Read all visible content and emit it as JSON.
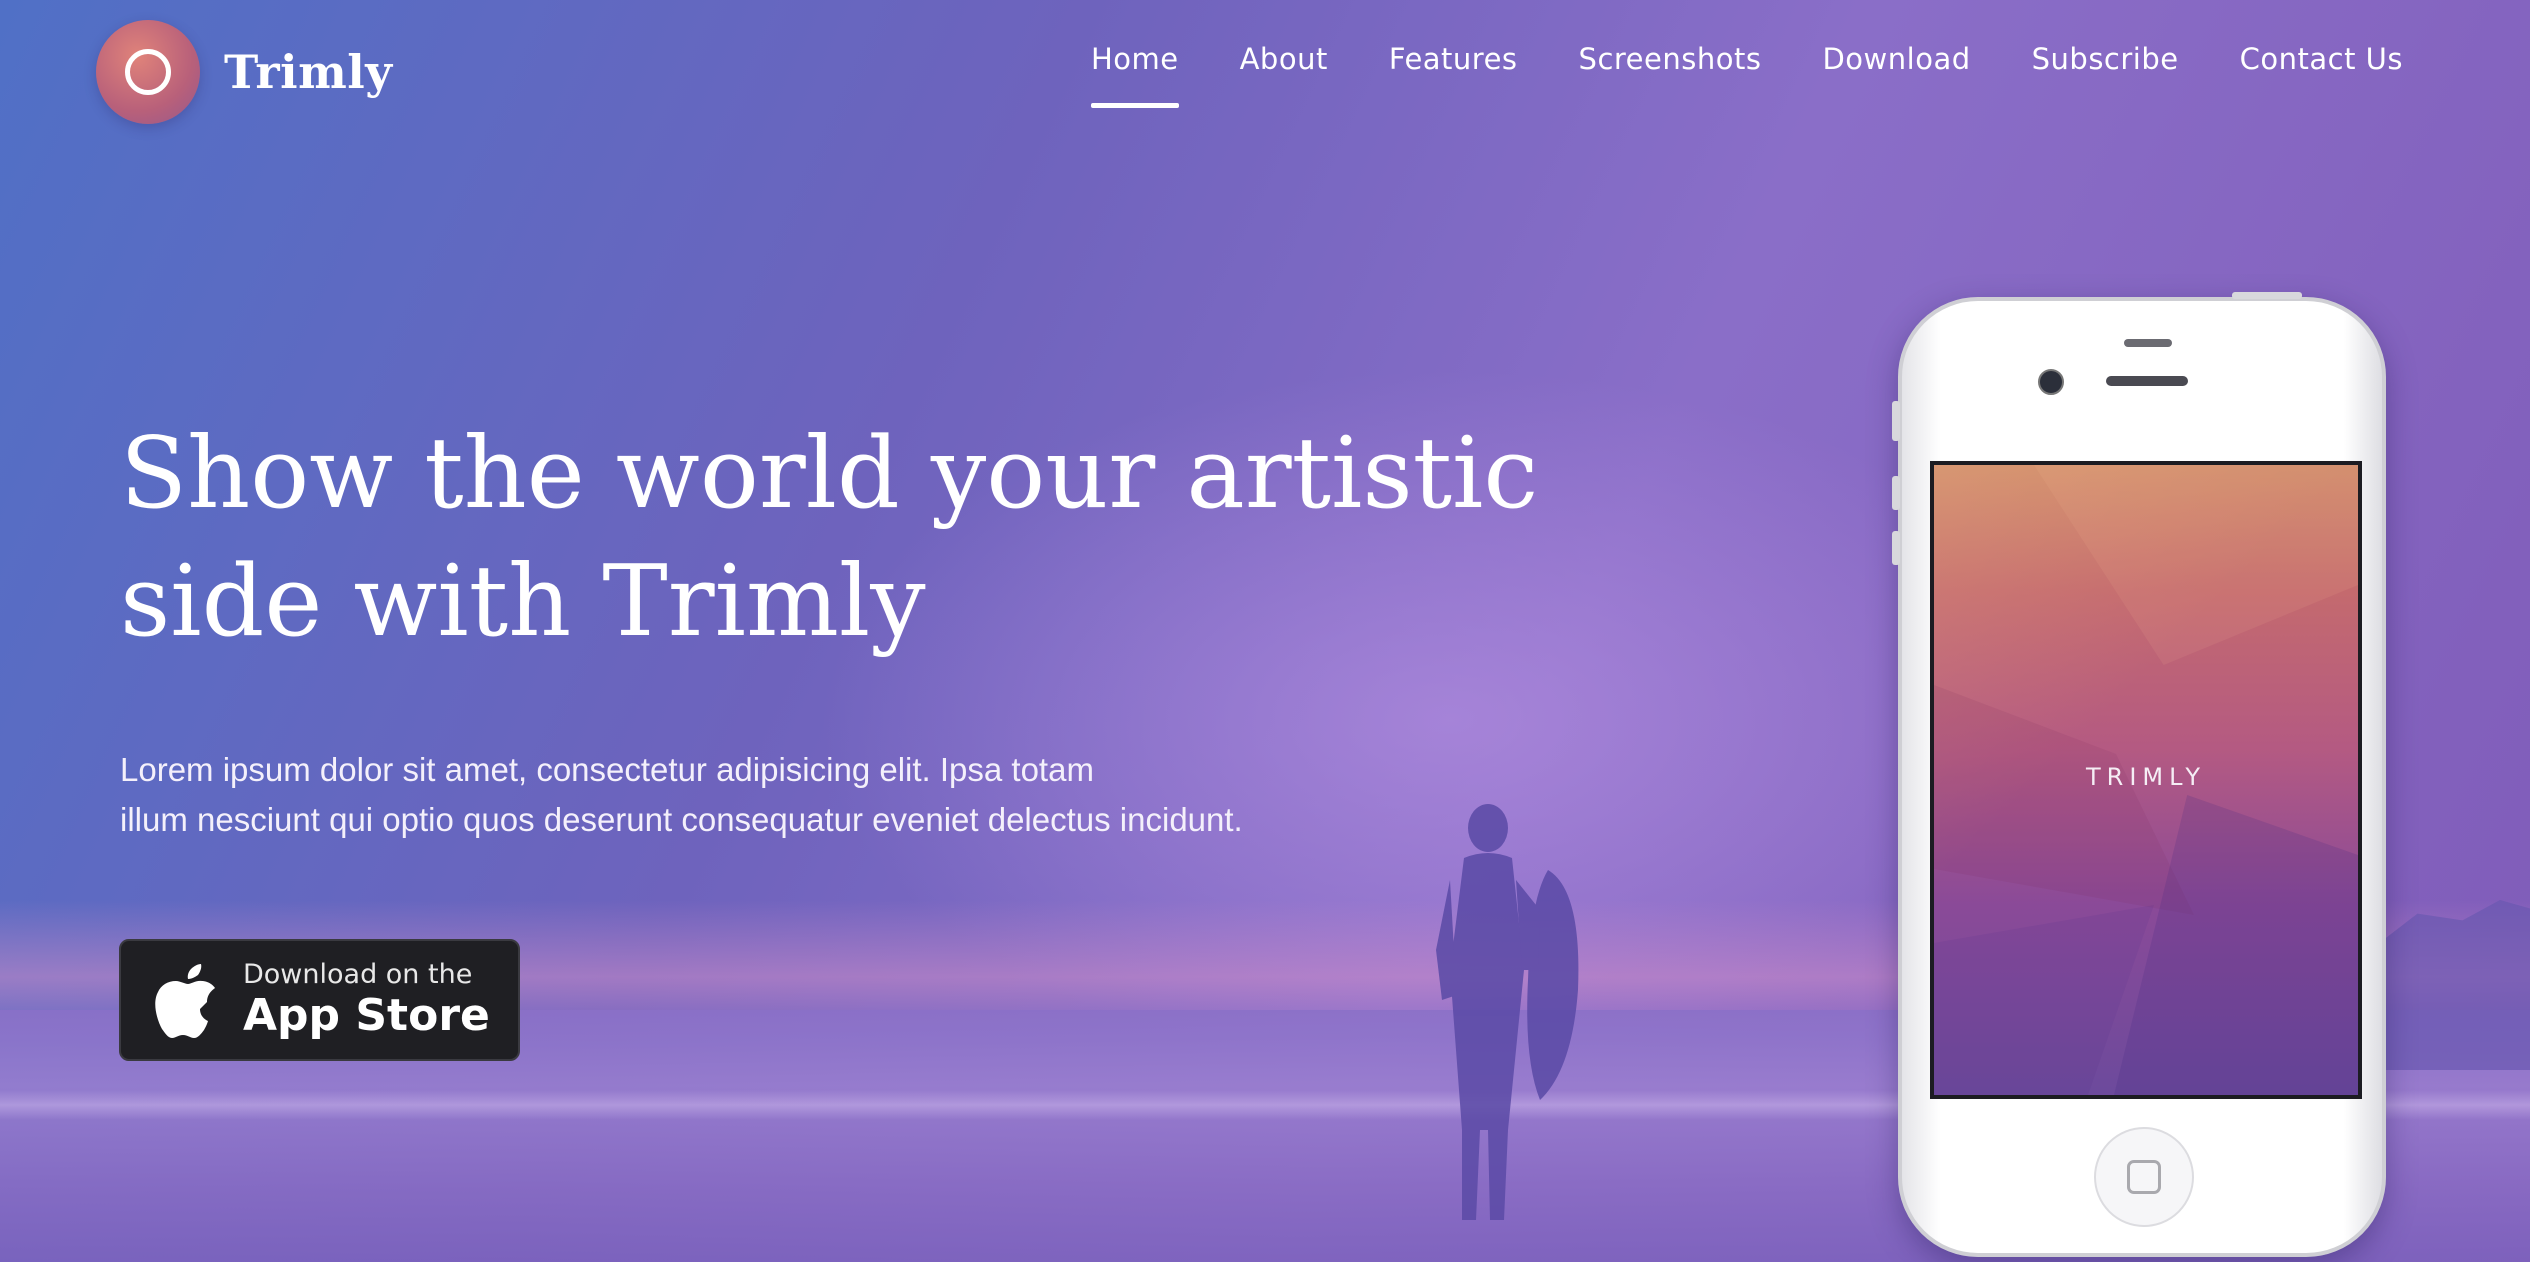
{
  "brand": {
    "name": "Trimly"
  },
  "nav": {
    "items": [
      "Home",
      "About",
      "Features",
      "Screenshots",
      "Download",
      "Subscribe",
      "Contact Us"
    ],
    "active": "Home"
  },
  "hero": {
    "headline_line1": "Show the world your artistic",
    "headline_line2": "side with Trimly",
    "sub_line1": "Lorem ipsum dolor sit amet, consectetur adipisicing elit. Ipsa totam",
    "sub_line2": "illum nesciunt qui optio quos deserunt consequatur eveniet delectus incidunt.",
    "appstore": {
      "small": "Download on the",
      "big": "App Store",
      "icon": "apple-icon"
    }
  },
  "phone": {
    "screen_label": "TRIMLY"
  },
  "colors": {
    "bg_start": "#5070c6",
    "bg_end": "#8a6ec8",
    "logo_accent": "#c9667a",
    "appstore_bg": "#1f1f23"
  }
}
